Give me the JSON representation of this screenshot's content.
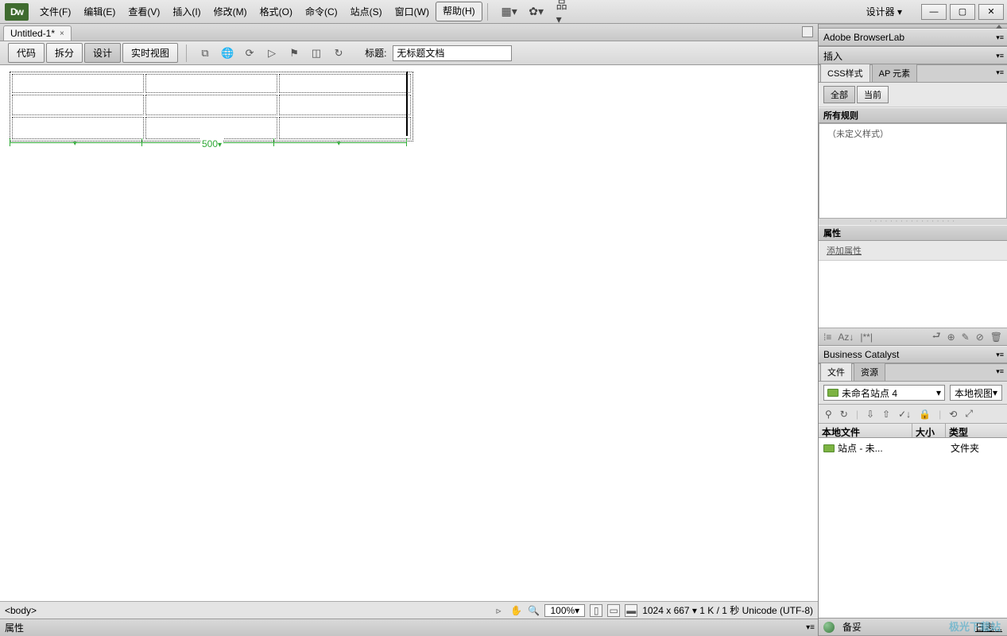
{
  "menubar": {
    "logo": "Dw",
    "items": [
      "文件(F)",
      "编辑(E)",
      "查看(V)",
      "插入(I)",
      "修改(M)",
      "格式(O)",
      "命令(C)",
      "站点(S)",
      "窗口(W)",
      "帮助(H)"
    ],
    "designer": "设计器 ▾"
  },
  "doc_tab": {
    "name": "Untitled-1*",
    "close": "×"
  },
  "toolbar": {
    "views": [
      "代码",
      "拆分",
      "设计",
      "实时视图"
    ],
    "active_view": 2,
    "title_label": "标题:",
    "title_value": "无标题文档"
  },
  "canvas": {
    "ruler_value": "500"
  },
  "status": {
    "tag_path": "<body>",
    "zoom": "100%",
    "info": "1024 x 667 ▾ 1 K / 1 秒 Unicode (UTF-8)"
  },
  "properties_label": "属性",
  "right": {
    "browserlab": "Adobe BrowserLab",
    "insert": "插入",
    "css_tabs": [
      "CSS样式",
      "AP 元素"
    ],
    "css_btns": [
      "全部",
      "当前"
    ],
    "rules_header": "所有规则",
    "rules_text": "（未定义样式）",
    "prop_header": "属性",
    "add_prop": "添加属性",
    "bizcat": "Business Catalyst",
    "file_tabs": [
      "文件",
      "资源"
    ],
    "site_name": "未命名站点 4",
    "view_name": "本地视图",
    "file_cols": [
      "本地文件",
      "大小",
      "类型"
    ],
    "file_row": {
      "name": "站点 - 未...",
      "size": "",
      "type": "文件夹"
    },
    "bottom": {
      "backup": "备妥",
      "log": "日志..."
    }
  },
  "watermark": "极光下载站"
}
